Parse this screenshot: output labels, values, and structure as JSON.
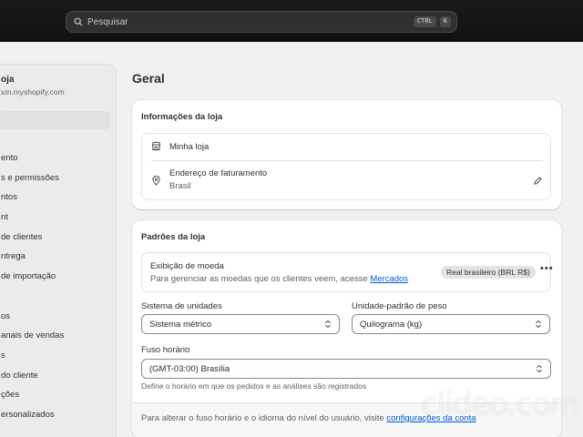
{
  "search": {
    "placeholder": "Pesquisar",
    "shortcut_1": "CTRL",
    "shortcut_2": "K"
  },
  "sidebar": {
    "store_name": "oja",
    "store_url": "xm.myshopify.com",
    "items": [
      {
        "label": "ento"
      },
      {
        "label": "s e permissões"
      },
      {
        "label": "ntos"
      },
      {
        "label": "nt"
      },
      {
        "label": "de clientes"
      },
      {
        "label": "ntrega"
      },
      {
        "label": "de importação"
      },
      {
        "label": ""
      },
      {
        "label": "os"
      },
      {
        "label": "anais de vendas"
      },
      {
        "label": "s"
      },
      {
        "label": "do cliente"
      },
      {
        "label": "ções"
      },
      {
        "label": "ersonalizados"
      }
    ]
  },
  "page": {
    "title": "Geral"
  },
  "store_info": {
    "title": "Informações da loja",
    "store_name_value": "Minha loja",
    "billing_label": "Endereço de faturamento",
    "billing_value": "Brasil"
  },
  "defaults": {
    "title": "Padrões da loja",
    "currency_label": "Exibição de moeda",
    "currency_desc": "Para gerenciar as moedas que os clientes veem, acesse",
    "currency_link": "Mercados",
    "currency_badge": "Real brasileiro (BRL R$)",
    "units_label": "Sistema de unidades",
    "units_value": "Sistema métrico",
    "weight_label": "Unidade-padrão de peso",
    "weight_value": "Quilograma (kg)",
    "timezone_label": "Fuso horário",
    "timezone_value": "(GMT-03:00) Brasília",
    "timezone_help": "Define o horário em que os pedidos e as análises são registrados",
    "footer_text": "Para alterar o fuso horário e o idioma do nível do usuário, visite",
    "footer_link": "configurações da conta"
  },
  "watermark": "clideo.com"
}
